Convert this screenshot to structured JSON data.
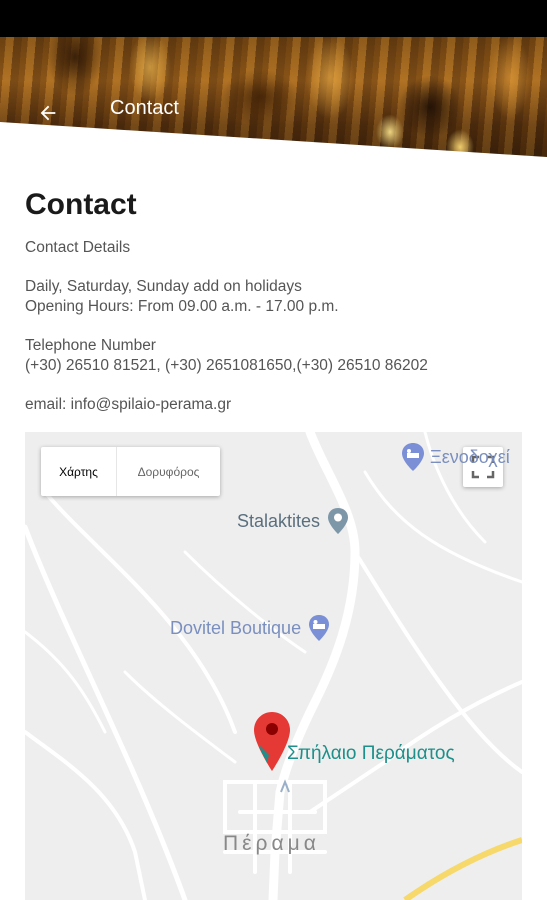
{
  "header": {
    "title": "Contact",
    "back_icon": "arrow-left-icon"
  },
  "content": {
    "page_title": "Contact",
    "subtitle": "Contact Details",
    "hours_line1": "Daily, Saturday, Sunday add on holidays",
    "hours_line2": "Opening Hours: From 09.00 a.m. - 17.00 p.m.",
    "phone_label": "Telephone Number",
    "phone_numbers": "(+30) 26510 81521, (+30) 2651081650,(+30) 26510 86202",
    "email": "email: info@spilaio-perama.gr"
  },
  "map": {
    "type_options": [
      "Χάρτης",
      "Δορυφόρος"
    ],
    "selected_type": "Χάρτης",
    "pois": {
      "top_right": "Ξενοδοχεί",
      "stalaktites": "Stalaktites",
      "dovitel": "Dovitel Boutique",
      "cave": "Σπήλαιο Περάματος"
    },
    "town": "Πέραμα",
    "pin_color": "#e53935",
    "accent_color": "#1e8f8a"
  }
}
